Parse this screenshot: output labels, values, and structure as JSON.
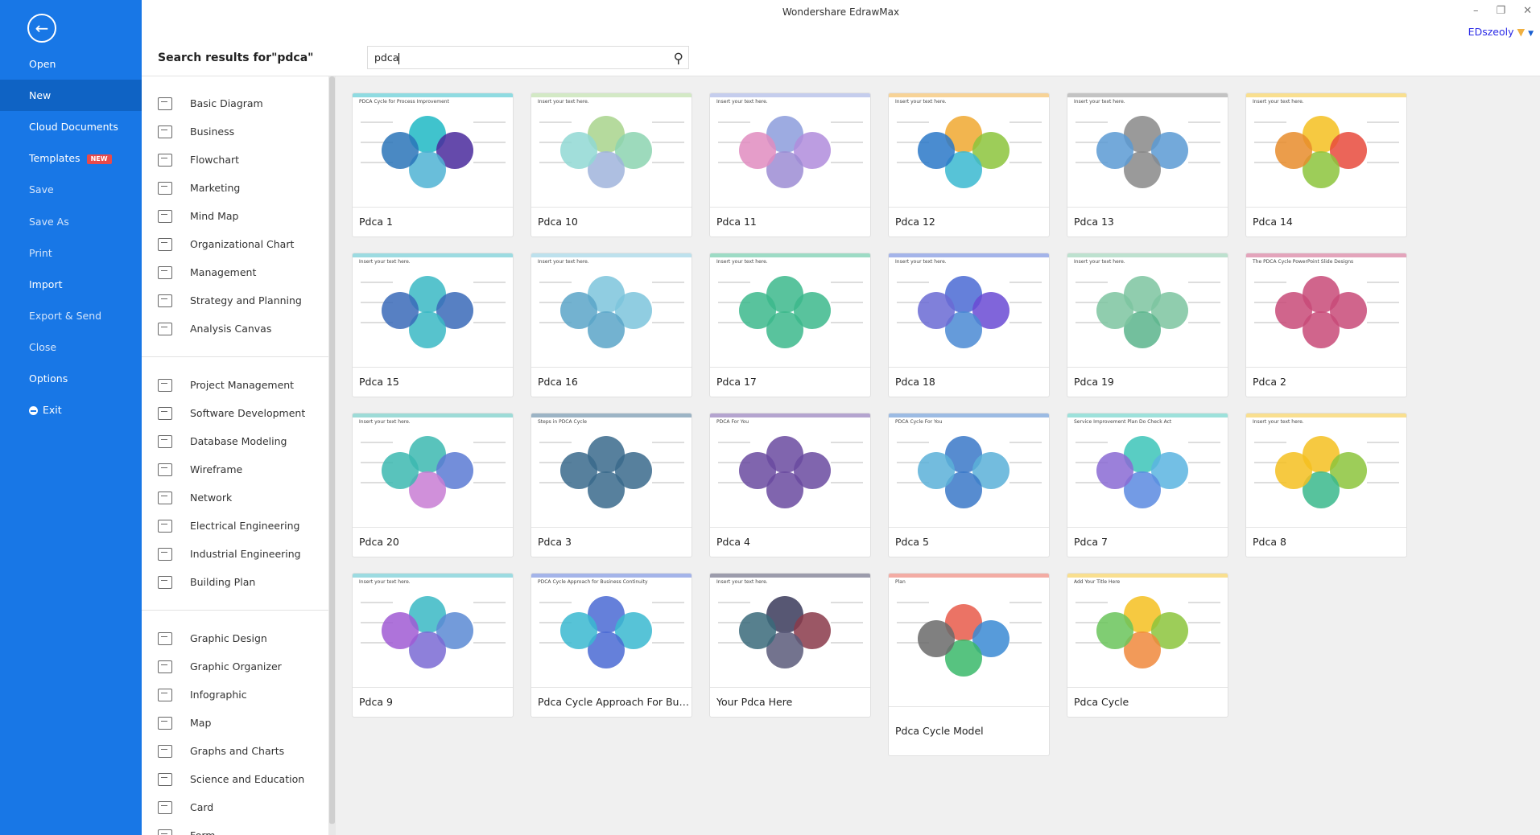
{
  "app": {
    "title": "Wondershare EdrawMax",
    "user": "EDszeoly"
  },
  "sidebar": {
    "items": [
      {
        "label": "Open"
      },
      {
        "label": "New",
        "active": true
      },
      {
        "label": "Cloud Documents"
      },
      {
        "label": "Templates",
        "badge": "NEW"
      },
      {
        "label": "Save",
        "dim": true
      },
      {
        "label": "Save As",
        "dim": true
      },
      {
        "label": "Print",
        "dim": true
      },
      {
        "label": "Import"
      },
      {
        "label": "Export & Send",
        "dim": true
      },
      {
        "label": "Close",
        "dim": true
      },
      {
        "label": "Options"
      },
      {
        "label": "Exit"
      }
    ]
  },
  "search": {
    "title": "Search results for\"pdca\"",
    "value": "pdca"
  },
  "categories": [
    [
      "Basic Diagram",
      "Business",
      "Flowchart",
      "Marketing",
      "Mind Map",
      "Organizational Chart",
      "Management",
      "Strategy and Planning",
      "Analysis Canvas"
    ],
    [
      "Project Management",
      "Software Development",
      "Database Modeling",
      "Wireframe",
      "Network",
      "Electrical Engineering",
      "Industrial Engineering",
      "Building Plan"
    ],
    [
      "Graphic Design",
      "Graphic Organizer",
      "Infographic",
      "Map",
      "Graphs and Charts",
      "Science and Education",
      "Card",
      "Form"
    ]
  ],
  "templates": [
    {
      "name": "Pdca 1",
      "heading": "PDCA Cycle for Process Improvement",
      "colors": [
        "#1fb8c4",
        "#4a2a9c",
        "#4fb3d4",
        "#2a74b8"
      ]
    },
    {
      "name": "Pdca 10",
      "heading": "Insert your text here.",
      "colors": [
        "#a8d48c",
        "#8cd4b0",
        "#a0b4dc",
        "#90d8d4"
      ]
    },
    {
      "name": "Pdca 11",
      "heading": "Insert your text here.",
      "colors": [
        "#8c9cdc",
        "#b08cdc",
        "#9c8cd4",
        "#e08cc0"
      ]
    },
    {
      "name": "Pdca 12",
      "heading": "Insert your text here.",
      "colors": [
        "#f0a830",
        "#8cc43c",
        "#3ab8d0",
        "#2a78c8"
      ]
    },
    {
      "name": "Pdca 13",
      "heading": "Insert your text here.",
      "colors": [
        "#888888",
        "#5a9ad4",
        "#888888",
        "#5a9ad4"
      ]
    },
    {
      "name": "Pdca 14",
      "heading": "Insert your text here.",
      "colors": [
        "#f4c020",
        "#e84a3c",
        "#8cc43c",
        "#e88c2c"
      ]
    },
    {
      "name": "Pdca 15",
      "heading": "Insert your text here.",
      "colors": [
        "#3ab8c4",
        "#3a6ab8",
        "#3ab8c4",
        "#3a6ab8"
      ]
    },
    {
      "name": "Pdca 16",
      "heading": "Insert your text here.",
      "colors": [
        "#7cc4dc",
        "#7cc4dc",
        "#5aa4c8",
        "#5aa4c8"
      ]
    },
    {
      "name": "Pdca 17",
      "heading": "Insert your text here.",
      "colors": [
        "#3cb88c",
        "#3cb88c",
        "#3cb88c",
        "#3cb88c"
      ]
    },
    {
      "name": "Pdca 18",
      "heading": "Insert your text here.",
      "colors": [
        "#4a6ad4",
        "#6a4ad4",
        "#4a8ad4",
        "#6a6ad4"
      ]
    },
    {
      "name": "Pdca 19",
      "heading": "Insert your text here.",
      "colors": [
        "#7cc4a0",
        "#7cc4a0",
        "#5ab48c",
        "#7cc4a0"
      ]
    },
    {
      "name": "Pdca 2",
      "heading": "The PDCA Cycle PowerPoint Slide Designs",
      "colors": [
        "#c84a78",
        "#c84a78",
        "#c84a78",
        "#c84a78"
      ]
    },
    {
      "name": "Pdca 20",
      "heading": "Insert your text here.",
      "colors": [
        "#3cb8b0",
        "#5a7ad4",
        "#c87cd4",
        "#3cb8b0"
      ]
    },
    {
      "name": "Pdca 3",
      "heading": "Steps in PDCA Cycle",
      "colors": [
        "#3a6a8c",
        "#3a6a8c",
        "#3a6a8c",
        "#3a6a8c"
      ]
    },
    {
      "name": "Pdca 4",
      "heading": "PDCA For You",
      "colors": [
        "#6a4aa0",
        "#6a4aa0",
        "#6a4aa0",
        "#6a4aa0"
      ]
    },
    {
      "name": "Pdca 5",
      "heading": "PDCA Cycle For You",
      "colors": [
        "#3a78c8",
        "#5ab0d8",
        "#3a78c8",
        "#5ab0d8"
      ]
    },
    {
      "name": "Pdca 7",
      "heading": "Service Improvement Plan Do Check Act",
      "colors": [
        "#3cc4b8",
        "#5ab4e0",
        "#5a8ae0",
        "#8a6ad4"
      ]
    },
    {
      "name": "Pdca 8",
      "heading": "Insert your text here.",
      "colors": [
        "#f4c020",
        "#8cc43c",
        "#3ab88c",
        "#f4c020"
      ]
    },
    {
      "name": "Pdca 9",
      "heading": "Insert your text here.",
      "colors": [
        "#3ab8c4",
        "#5a8ad4",
        "#7a6ad4",
        "#a05ad4"
      ]
    },
    {
      "name": "Pdca Cycle Approach For Busine...",
      "heading": "PDCA Cycle Approach for Business Continuity",
      "colors": [
        "#4a6ad4",
        "#3ab8d0",
        "#4a6ad4",
        "#3ab8d0"
      ]
    },
    {
      "name": "Your Pdca Here",
      "heading": "Insert your text here.",
      "colors": [
        "#3a3a5a",
        "#8a3a4a",
        "#5a5a7a",
        "#3a6a7a"
      ]
    },
    {
      "name": "Pdca Cycle Model",
      "heading": "Plan",
      "tall": true,
      "colors": [
        "#e85a4a",
        "#3a8ad4",
        "#3ab86a",
        "#6a6a6a"
      ]
    },
    {
      "name": "Pdca Cycle",
      "heading": "Add Your Title Here",
      "colors": [
        "#f4c020",
        "#8cc43c",
        "#f0883c",
        "#6ac45a"
      ]
    }
  ]
}
